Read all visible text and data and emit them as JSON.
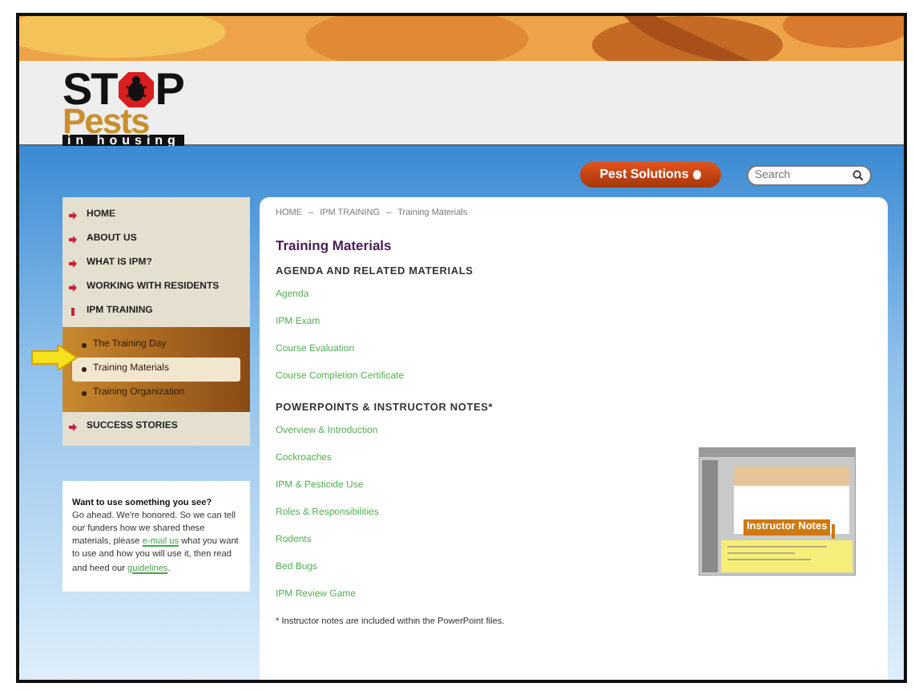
{
  "logo": {
    "word_top_left": "ST",
    "word_top_right": "P",
    "word_middle": "Pests",
    "tagline": "in housing"
  },
  "header": {
    "solutions_button": "Pest Solutions",
    "search": {
      "placeholder": "Search"
    }
  },
  "sidebar": {
    "items": [
      {
        "label": "HOME",
        "expanded": false
      },
      {
        "label": "ABOUT US",
        "expanded": false
      },
      {
        "label": "WHAT IS IPM?",
        "expanded": false
      },
      {
        "label": "WORKING WITH RESIDENTS",
        "expanded": false
      },
      {
        "label": "IPM TRAINING",
        "expanded": true,
        "children": [
          {
            "label": "The Training Day",
            "selected": false
          },
          {
            "label": "Training Materials",
            "selected": true
          },
          {
            "label": "Training Organization",
            "selected": false
          }
        ]
      },
      {
        "label": "SUCCESS STORIES",
        "expanded": false
      }
    ]
  },
  "note": {
    "heading": "Want to use something you see?",
    "parts": [
      {
        "kind": "text",
        "text": "Go ahead. We're honored. So we can tell our funders how we shared these materials, please "
      },
      {
        "kind": "link",
        "text": "e-mail us"
      },
      {
        "kind": "text",
        "text": " what you want to use and how you will use it, then read and heed our "
      },
      {
        "kind": "link",
        "text": "guidelines"
      },
      {
        "kind": "text",
        "text": "."
      }
    ]
  },
  "breadcrumb": {
    "separator": "–",
    "items": [
      "HOME",
      "IPM TRAINING",
      "Training Materials"
    ]
  },
  "page_title": "Training Materials",
  "sections": [
    {
      "heading": "AGENDA AND RELATED MATERIALS",
      "links": [
        "Agenda",
        "IPM Exam",
        "Course Evaluation",
        "Course Completion Certificate"
      ]
    },
    {
      "heading": "POWERPOINTS & INSTRUCTOR NOTES*",
      "links": [
        "Overview & Introduction",
        "Cockroaches",
        "IPM & Pesticide Use",
        "Roles & Responsibilities",
        "Rodents",
        "Bed Bugs",
        "IPM Review Game"
      ]
    }
  ],
  "footnote": "* Instructor notes are included within the PowerPoint files.",
  "thumbnail": {
    "callout": "Instructor Notes"
  }
}
